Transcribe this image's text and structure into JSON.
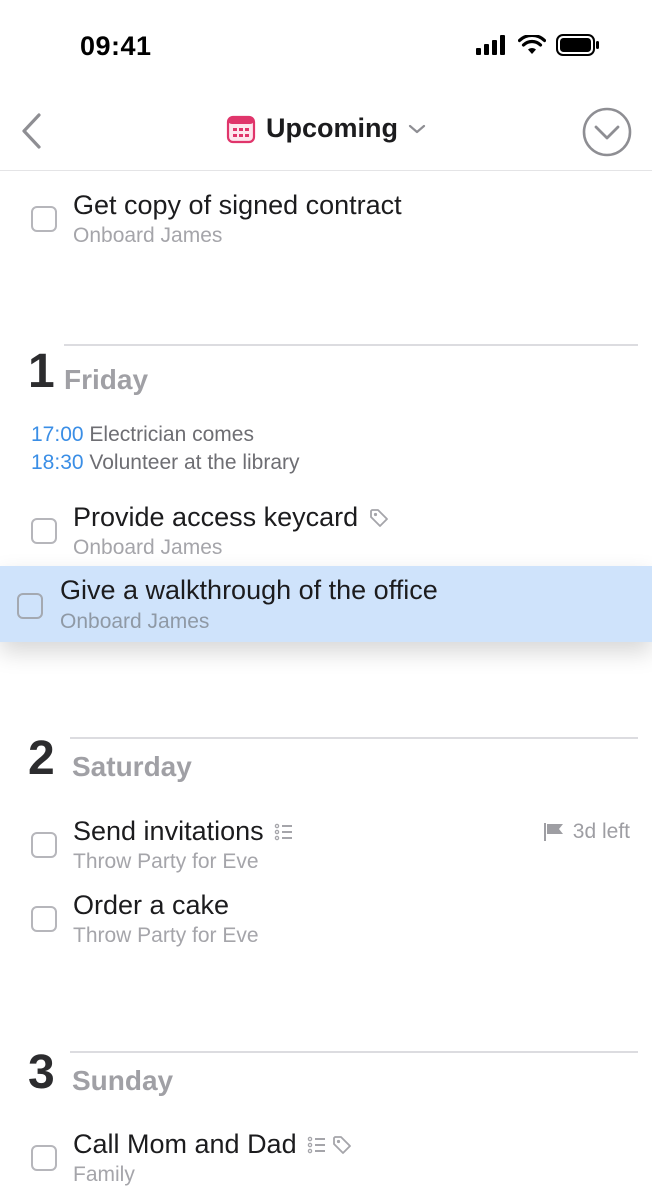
{
  "status_bar": {
    "time": "09:41"
  },
  "nav": {
    "title": "Upcoming",
    "accent_color": "#e0356b"
  },
  "tasks_top": [
    {
      "title": "Get copy of signed contract",
      "project": "Onboard James"
    }
  ],
  "days": [
    {
      "number": "1",
      "name": "Friday",
      "events": [
        {
          "time": "17:00",
          "text": "Electrician comes"
        },
        {
          "time": "18:30",
          "text": "Volunteer at the library"
        }
      ],
      "tasks": [
        {
          "title": "Provide access keycard",
          "project": "Onboard James",
          "icons": [
            "tag-icon"
          ]
        }
      ]
    },
    {
      "number": "2",
      "name": "Saturday",
      "tasks": [
        {
          "title": "Send invitations",
          "project": "Throw Party for Eve",
          "icons": [
            "checklist-icon"
          ],
          "deadline": "3d left"
        },
        {
          "title": "Order a cake",
          "project": "Throw Party for Eve"
        }
      ]
    },
    {
      "number": "3",
      "name": "Sunday",
      "tasks": [
        {
          "title": "Call Mom and Dad",
          "project": "Family",
          "icons": [
            "checklist-icon",
            "tag-icon"
          ]
        }
      ]
    }
  ],
  "dragging_task": {
    "title": "Give a walkthrough of the office",
    "project": "Onboard James",
    "highlight_color": "#cfe3fb"
  }
}
